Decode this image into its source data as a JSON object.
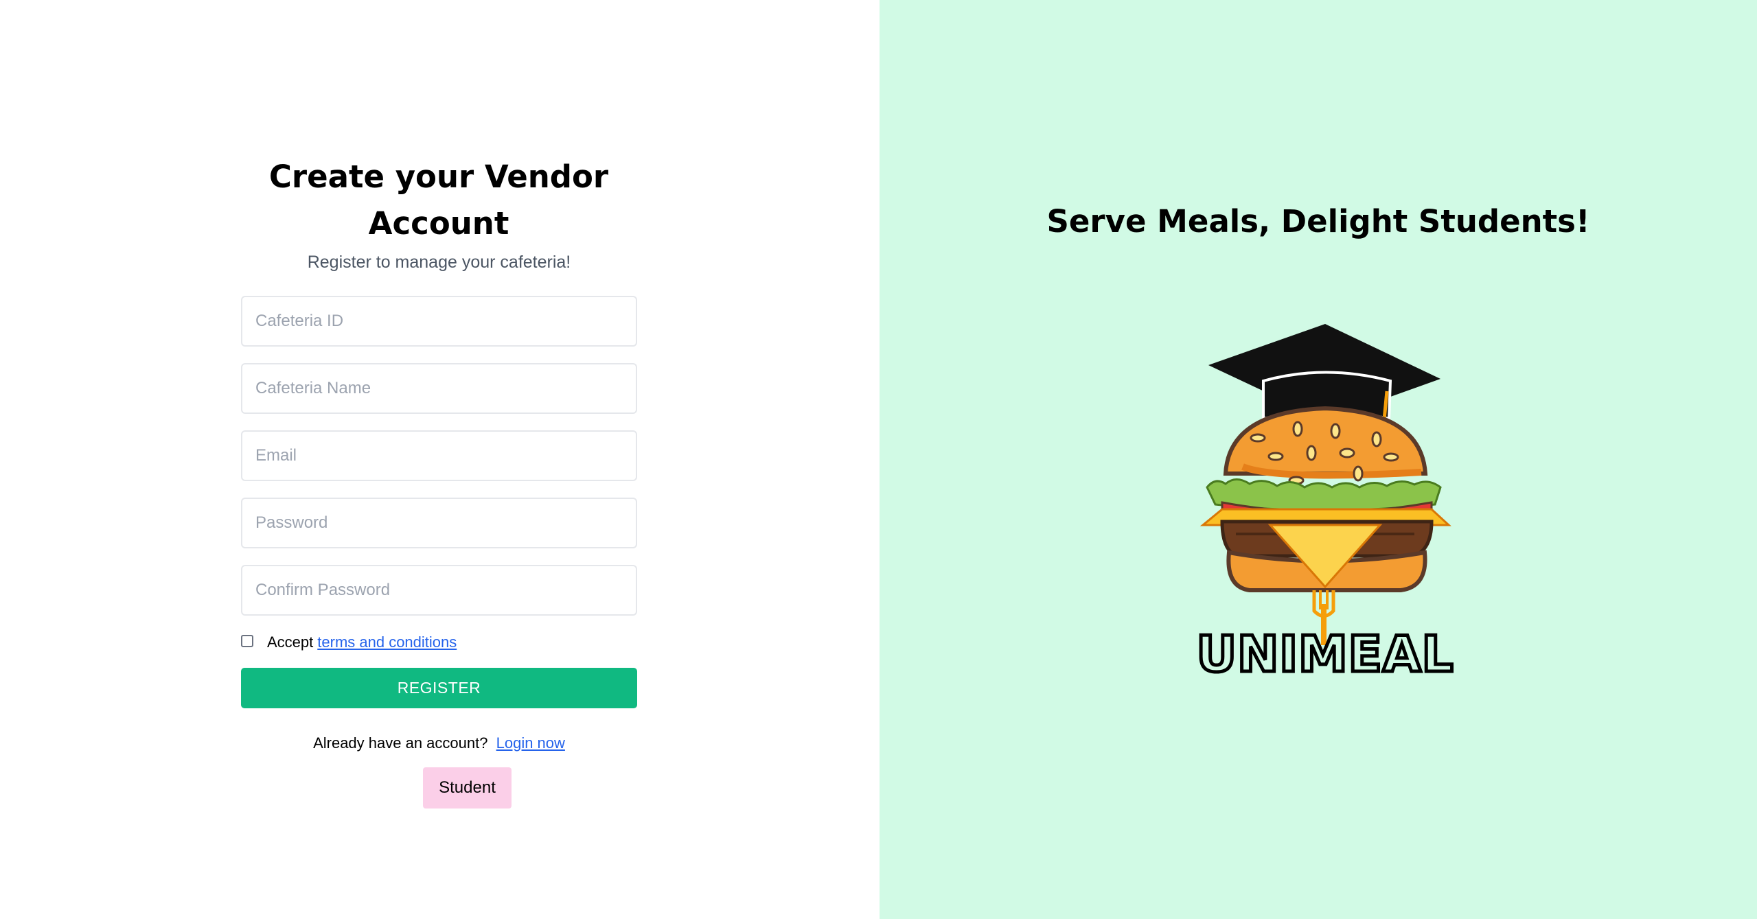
{
  "form": {
    "title": "Create your Vendor Account",
    "subtitle": "Register to manage your cafeteria!",
    "fields": {
      "cafeteria_id": {
        "placeholder": "Cafeteria ID",
        "value": ""
      },
      "cafeteria_name": {
        "placeholder": "Cafeteria Name",
        "value": ""
      },
      "email": {
        "placeholder": "Email",
        "value": ""
      },
      "password": {
        "placeholder": "Password",
        "value": ""
      },
      "confirm_password": {
        "placeholder": "Confirm Password",
        "value": ""
      }
    },
    "terms": {
      "prefix": "Accept",
      "link": "terms and conditions",
      "checked": false
    },
    "register_label": "REGISTER",
    "login": {
      "prefix": "Already have an account?",
      "link": "Login now"
    },
    "student_label": "Student"
  },
  "hero": {
    "tagline": "Serve Meals, Delight Students!",
    "logo_text": "UNIMEAL",
    "logo_icon": "burger-graduation-cap-icon"
  },
  "colors": {
    "right_bg": "#d1fae5",
    "register_bg": "#10b981",
    "student_bg": "#fbcfe8",
    "link": "#2563eb"
  }
}
